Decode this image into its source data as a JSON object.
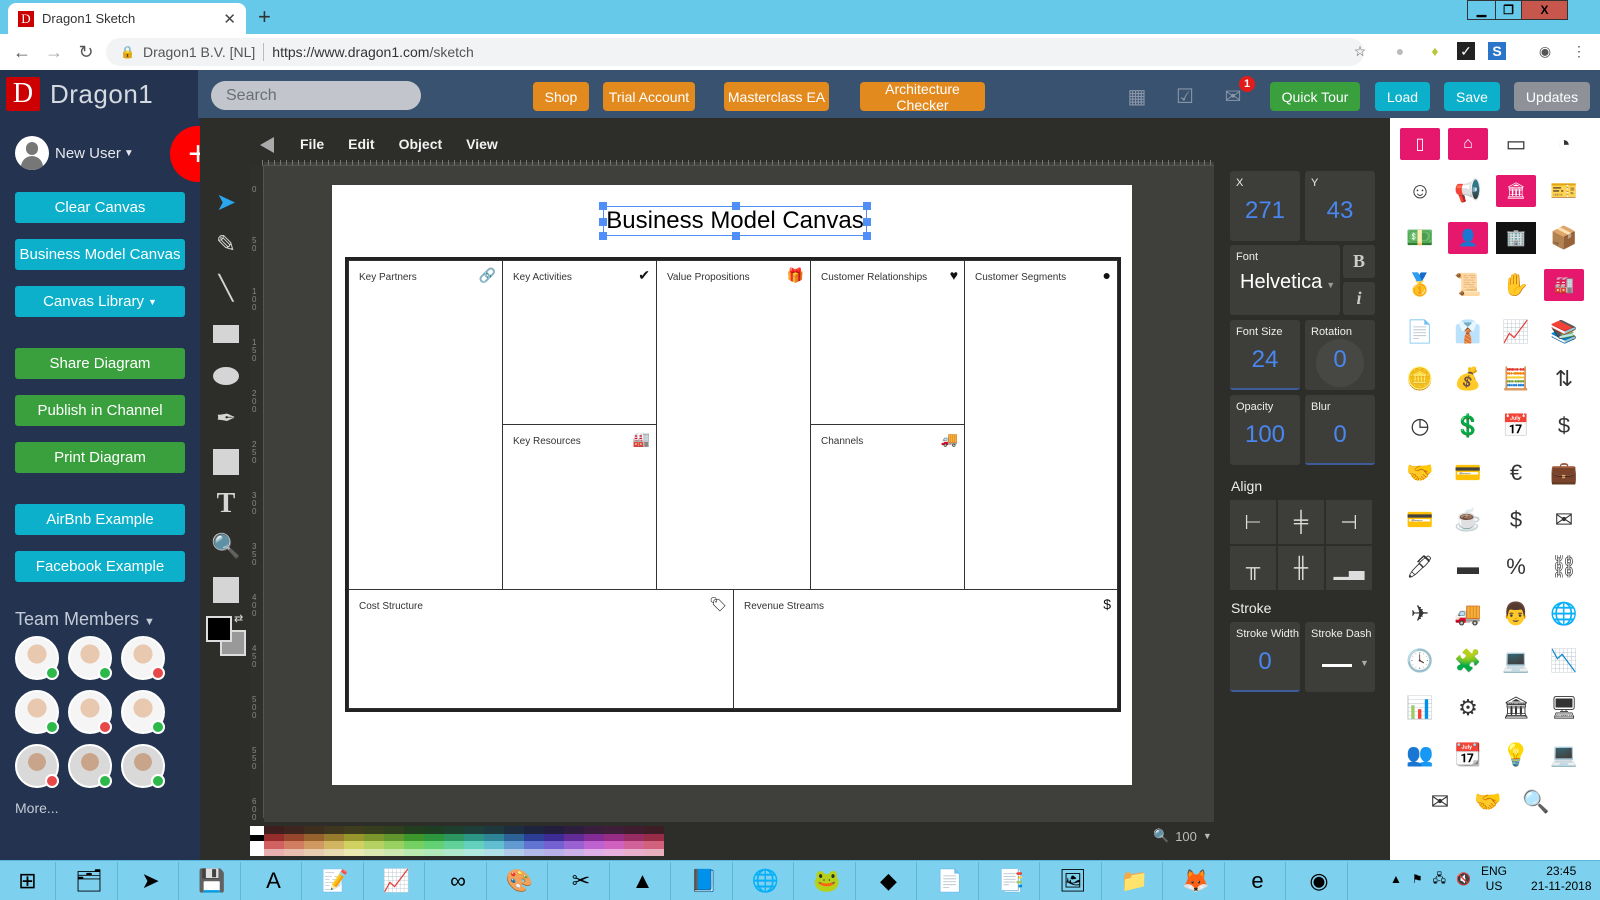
{
  "browser": {
    "tab_title": "Dragon1 Sketch",
    "favicon_letter": "D",
    "site_identity": "Dragon1 B.V. [NL]",
    "url_host": "https://www.dragon1.com",
    "url_path": "/sketch",
    "window_controls": {
      "minimize": "▁",
      "restore": "❐",
      "close": "X"
    }
  },
  "app": {
    "logo_letter": "D",
    "logo_name": "Dragon1",
    "search_placeholder": "Search",
    "header_buttons": [
      {
        "label": "Shop",
        "color": "#e38a1f"
      },
      {
        "label": "Trial Account",
        "color": "#e38a1f"
      },
      {
        "label": "Masterclass EA",
        "color": "#e38a1f"
      },
      {
        "label": "Architecture Checker",
        "color": "#e38a1f"
      },
      {
        "label": "Quick Tour",
        "color": "#3aa03e"
      },
      {
        "label": "Load",
        "color": "#0cb0ca"
      },
      {
        "label": "Save",
        "color": "#0cb0ca"
      },
      {
        "label": "Updates",
        "color": "#8e9198"
      }
    ],
    "mail_badge": "1"
  },
  "sidebar": {
    "user_name": "New User",
    "add_label": "+",
    "buttons": [
      {
        "label": "Clear Canvas",
        "color": "#0cb0ca"
      },
      {
        "label": "Business Model Canvas",
        "color": "#0cb0ca"
      },
      {
        "label": "Canvas Library",
        "color": "#0cb0ca",
        "dropdown": true
      },
      {
        "label": "Share Diagram",
        "color": "#3aa03e"
      },
      {
        "label": "Publish in Channel",
        "color": "#3aa03e"
      },
      {
        "label": "Print Diagram",
        "color": "#3aa03e"
      },
      {
        "label": "AirBnb Example",
        "color": "#0cb0ca"
      },
      {
        "label": "Facebook Example",
        "color": "#0cb0ca"
      }
    ],
    "team_header": "Team Members",
    "team_members": [
      {
        "status": "online",
        "color": "#2db84a"
      },
      {
        "status": "online",
        "color": "#2db84a"
      },
      {
        "status": "busy",
        "color": "#e84848"
      },
      {
        "status": "online",
        "color": "#2db84a"
      },
      {
        "status": "busy",
        "color": "#e84848"
      },
      {
        "status": "online",
        "color": "#2db84a"
      },
      {
        "status": "busy",
        "color": "#e84848"
      },
      {
        "status": "online",
        "color": "#2db84a"
      },
      {
        "status": "online",
        "color": "#2db84a"
      }
    ],
    "more_label": "More..."
  },
  "tools": [
    "select-icon",
    "pencil-icon",
    "line-icon",
    "rectangle-icon",
    "ellipse-icon",
    "pen-icon",
    "image-icon",
    "text-icon",
    "zoom-icon",
    "shape-icon"
  ],
  "menu": [
    "File",
    "Edit",
    "Object",
    "View"
  ],
  "ruler_left": [
    "0",
    "50",
    "100",
    "150",
    "200",
    "250",
    "300",
    "350",
    "400",
    "450",
    "500",
    "550",
    "600"
  ],
  "canvas": {
    "title": "Business Model Canvas",
    "cells": {
      "key_partners": {
        "label": "Key Partners",
        "icon": "🔗"
      },
      "key_activities": {
        "label": "Key Activities",
        "icon": "✔"
      },
      "key_resources": {
        "label": "Key Resources",
        "icon": "🏭"
      },
      "value_propositions": {
        "label": "Value Propositions",
        "icon": "🎁"
      },
      "customer_relationships": {
        "label": "Customer Relationships",
        "icon": "♥"
      },
      "channels": {
        "label": "Channels",
        "icon": "🚚"
      },
      "customer_segments": {
        "label": "Customer Segments",
        "icon": "●"
      },
      "cost_structure": {
        "label": "Cost Structure",
        "icon": "🏷"
      },
      "revenue_streams": {
        "label": "Revenue Streams",
        "icon": "$"
      }
    }
  },
  "zoom": {
    "value": "100"
  },
  "properties": {
    "x_label": "X",
    "x_value": "271",
    "y_label": "Y",
    "y_value": "43",
    "font_label": "Font",
    "font_value": "Helvetica",
    "bold_label": "B",
    "italic_label": "i",
    "font_size_label": "Font Size",
    "font_size_value": "24",
    "rotation_label": "Rotation",
    "rotation_value": "0",
    "opacity_label": "Opacity",
    "opacity_value": "100",
    "blur_label": "Blur",
    "blur_value": "0",
    "align_header": "Align",
    "stroke_header": "Stroke",
    "stroke_width_label": "Stroke Width",
    "stroke_width_value": "0",
    "stroke_dash_label": "Stroke Dash"
  },
  "library_icons": [
    {
      "name": "phone-icon",
      "glyph": "▯",
      "style": "pink"
    },
    {
      "name": "house-icon",
      "glyph": "⌂",
      "style": "pink"
    },
    {
      "name": "credit-card-icon",
      "glyph": "▭",
      "style": ""
    },
    {
      "name": "chart-frame-icon",
      "glyph": "◔",
      "style": ""
    },
    {
      "name": "person-alert-icon",
      "glyph": "☺",
      "style": ""
    },
    {
      "name": "megaphone-icon",
      "glyph": "📢",
      "style": ""
    },
    {
      "name": "capitol-icon",
      "glyph": "🏛",
      "style": "pink"
    },
    {
      "name": "ticket-icon",
      "glyph": "🎫",
      "style": ""
    },
    {
      "name": "money-icon",
      "glyph": "💵",
      "style": ""
    },
    {
      "name": "person-desk-icon",
      "glyph": "👤",
      "style": "pink"
    },
    {
      "name": "building-icon",
      "glyph": "🏢",
      "style": "black"
    },
    {
      "name": "box-icon",
      "glyph": "📦",
      "style": ""
    },
    {
      "name": "podium-icon",
      "glyph": "🥇",
      "style": ""
    },
    {
      "name": "certificate-icon",
      "glyph": "📜",
      "style": ""
    },
    {
      "name": "hand-card-icon",
      "glyph": "✋",
      "style": ""
    },
    {
      "name": "factory-icon",
      "glyph": "🏭",
      "style": "pink"
    },
    {
      "name": "paper-icon",
      "glyph": "📄",
      "style": ""
    },
    {
      "name": "businessman-icon",
      "glyph": "👔",
      "style": ""
    },
    {
      "name": "growth-chart-icon",
      "glyph": "📈",
      "style": ""
    },
    {
      "name": "binders-icon",
      "glyph": "📚",
      "style": ""
    },
    {
      "name": "coins-icon",
      "glyph": "🪙",
      "style": ""
    },
    {
      "name": "money-bag-icon",
      "glyph": "💰",
      "style": ""
    },
    {
      "name": "calculator-icon",
      "glyph": "🧮",
      "style": ""
    },
    {
      "name": "arrows-updown-icon",
      "glyph": "⇅",
      "style": ""
    },
    {
      "name": "pie-chart-icon",
      "glyph": "◷",
      "style": ""
    },
    {
      "name": "dollar-bill-icon",
      "glyph": "💲",
      "style": ""
    },
    {
      "name": "calendar-icon",
      "glyph": "📅",
      "style": ""
    },
    {
      "name": "dollar-icon",
      "glyph": "$",
      "style": ""
    },
    {
      "name": "handshake-icon",
      "glyph": "🤝",
      "style": ""
    },
    {
      "name": "card-icon",
      "glyph": "💳",
      "style": ""
    },
    {
      "name": "euro-icon",
      "glyph": "€",
      "style": ""
    },
    {
      "name": "briefcase-icon",
      "glyph": "💼",
      "style": ""
    },
    {
      "name": "credit-card-2-icon",
      "glyph": "💳",
      "style": ""
    },
    {
      "name": "coffee-icon",
      "glyph": "☕",
      "style": ""
    },
    {
      "name": "dollar-stack-icon",
      "glyph": "$",
      "style": ""
    },
    {
      "name": "envelope-open-icon",
      "glyph": "✉",
      "style": ""
    },
    {
      "name": "pen-icon",
      "glyph": "🖊",
      "style": ""
    },
    {
      "name": "gold-bars-icon",
      "glyph": "▬",
      "style": ""
    },
    {
      "name": "percent-icon",
      "glyph": "%",
      "style": ""
    },
    {
      "name": "network-icon",
      "glyph": "⛓",
      "style": ""
    },
    {
      "name": "airplane-icon",
      "glyph": "✈",
      "style": ""
    },
    {
      "name": "truck-icon",
      "glyph": "🚚",
      "style": ""
    },
    {
      "name": "doctor-icon",
      "glyph": "👨",
      "style": ""
    },
    {
      "name": "globe-icon",
      "glyph": "🌐",
      "style": ""
    },
    {
      "name": "clock-icon",
      "glyph": "🕓",
      "style": ""
    },
    {
      "name": "puzzle-icon",
      "glyph": "🧩",
      "style": ""
    },
    {
      "name": "laptop-icon",
      "glyph": "💻",
      "style": ""
    },
    {
      "name": "line-chart-icon",
      "glyph": "📉",
      "style": ""
    },
    {
      "name": "bar-chart-icon",
      "glyph": "📊",
      "style": ""
    },
    {
      "name": "gears-icon",
      "glyph": "⚙",
      "style": ""
    },
    {
      "name": "bank-icon",
      "glyph": "🏛",
      "style": ""
    },
    {
      "name": "monitor-icon",
      "glyph": "🖥",
      "style": ""
    },
    {
      "name": "team-icon",
      "glyph": "👥",
      "style": ""
    },
    {
      "name": "desk-calendar-icon",
      "glyph": "📆",
      "style": ""
    },
    {
      "name": "lightbulb-icon",
      "glyph": "💡",
      "style": ""
    },
    {
      "name": "laptop-2-icon",
      "glyph": "💻",
      "style": ""
    },
    {
      "name": "envelope-icon",
      "glyph": "✉",
      "style": ""
    },
    {
      "name": "handshake-2-icon",
      "glyph": "🤝",
      "style": ""
    },
    {
      "name": "magnifier-icon",
      "glyph": "🔍",
      "style": ""
    }
  ],
  "taskbar": {
    "apps": [
      "windows-start-icon",
      "file-manager-icon",
      "powershell-icon",
      "save-disk-icon",
      "acrobat-icon",
      "notepad-icon",
      "resource-monitor-icon",
      "visual-studio-icon",
      "paint-icon",
      "snipping-icon",
      "inkscape-icon",
      "notepad2-icon",
      "network-icon",
      "gimp-icon",
      "virtualbox-icon",
      "wordpad-icon",
      "openoffice-icon",
      "photos-icon",
      "folder-icon",
      "firefox-icon",
      "internet-explorer-icon",
      "chrome-icon"
    ],
    "glyphs": [
      "⊞",
      "🗂",
      "➤",
      "💾",
      "A",
      "📝",
      "📈",
      "∞",
      "🎨",
      "✂",
      "▲",
      "📘",
      "🌐",
      "🐸",
      "◆",
      "📄",
      "📑",
      "🖼",
      "📁",
      "🦊",
      "e",
      "◉"
    ],
    "language": "ENG",
    "region": "US",
    "time": "23:45",
    "date": "21-11-2018"
  }
}
